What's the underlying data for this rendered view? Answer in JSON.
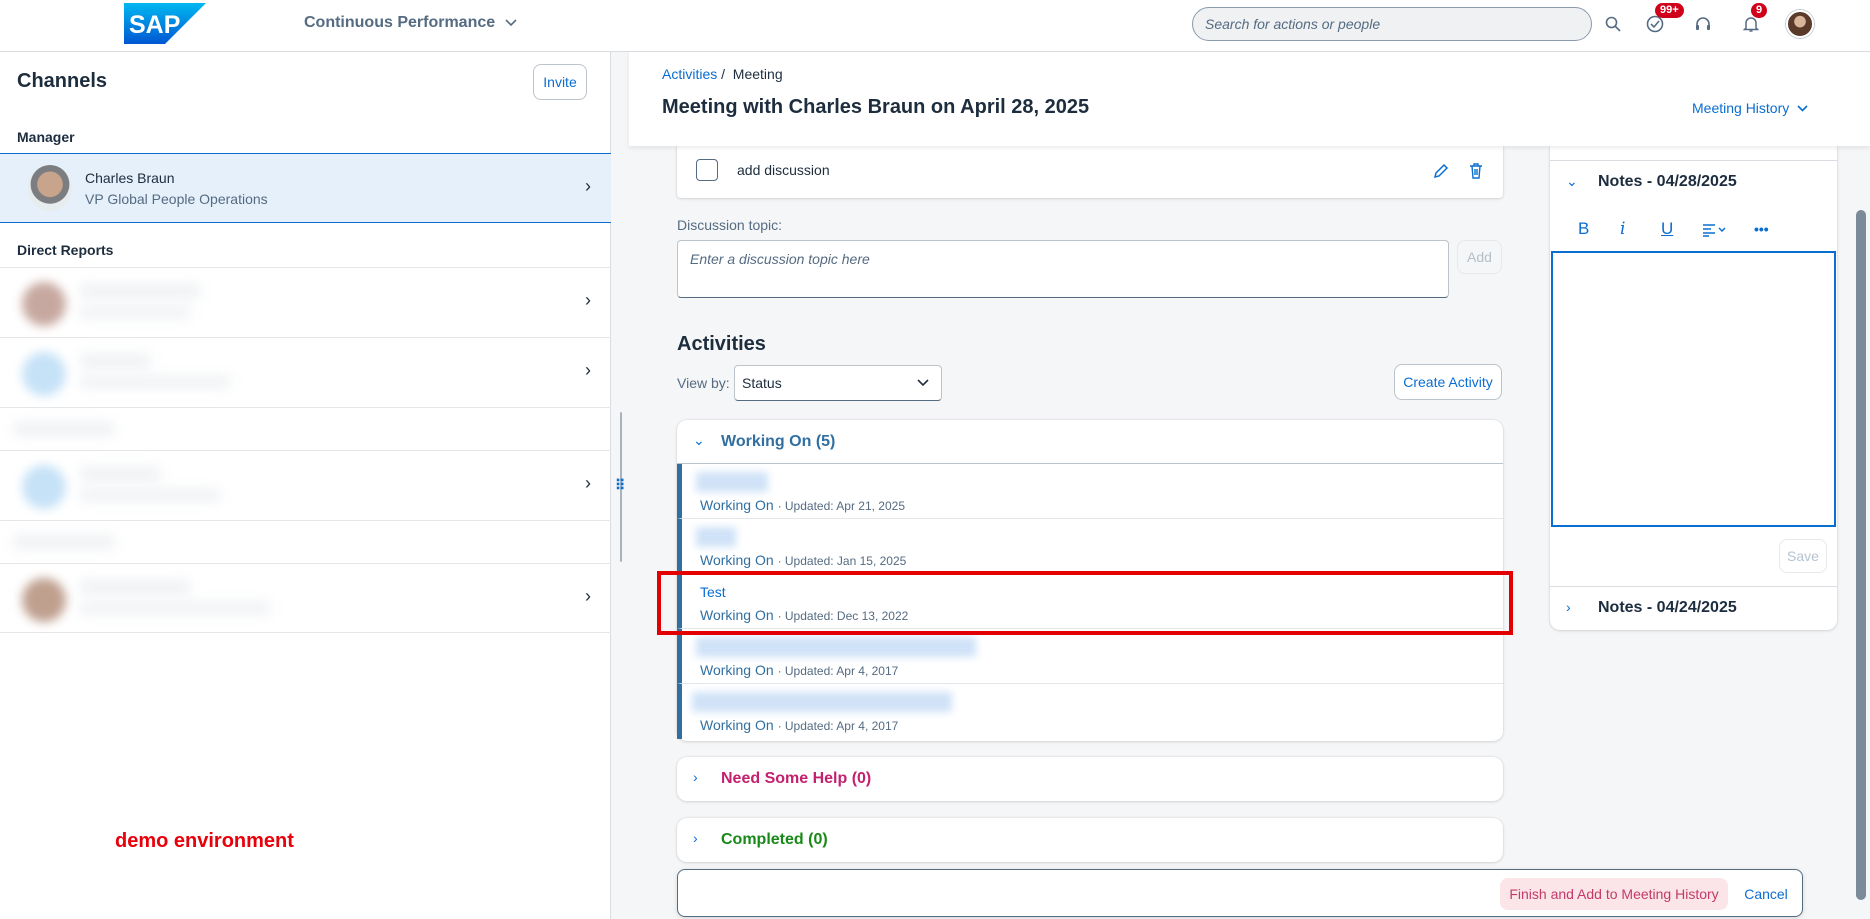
{
  "shell": {
    "logo_text": "SAP",
    "product": "Continuous Performance",
    "search_placeholder": "Search for actions or people",
    "todo_badge": "99+",
    "notifications_badge": "9"
  },
  "channels": {
    "title": "Channels",
    "invite_label": "Invite",
    "manager_label": "Manager",
    "manager": {
      "name": "Charles Braun",
      "title": "VP Global People Operations"
    },
    "direct_reports_label": "Direct Reports"
  },
  "demo_label": "demo environment",
  "header": {
    "breadcrumb_link": "Activities",
    "breadcrumb_sep": "/",
    "breadcrumb_current": "Meeting",
    "title": "Meeting with Charles Braun on April 28, 2025",
    "history_label": "Meeting History"
  },
  "topic": {
    "item_text": "add discussion",
    "field_label": "Discussion topic:",
    "input_placeholder": "Enter a discussion topic here",
    "add_label": "Add"
  },
  "activities": {
    "title": "Activities",
    "view_by_label": "View by:",
    "view_by_value": "Status",
    "create_label": "Create Activity",
    "groups": [
      {
        "label": "Working On (5)",
        "color": "#316fa1"
      },
      {
        "label": "Need Some Help (0)",
        "color": "#c3216e"
      },
      {
        "label": "Completed (0)",
        "color": "#188918"
      }
    ],
    "items": [
      {
        "title": "",
        "status": "Working On",
        "updated": "· Updated: Apr 21, 2025"
      },
      {
        "title": "",
        "status": "Working On",
        "updated": "· Updated: Jan 15, 2025"
      },
      {
        "title": "Test",
        "status": "Working On",
        "updated": "· Updated: Dec 13, 2022"
      },
      {
        "title": "",
        "status": "Working On",
        "updated": "· Updated: Apr 4, 2017"
      },
      {
        "title": "",
        "status": "Working On",
        "updated": "· Updated: Apr 4, 2017"
      }
    ]
  },
  "notes": {
    "current_title": "Notes - 04/28/2025",
    "previous_title": "Notes - 04/24/2025",
    "save_label": "Save",
    "toolbar": {
      "bold": "B",
      "italic": "i",
      "underline": "U",
      "more": "•••"
    }
  },
  "footer": {
    "finish_label": "Finish and Add to Meeting History",
    "cancel_label": "Cancel"
  },
  "colors": {
    "accent": "#0a6ed1",
    "highlight": "#e30000"
  }
}
